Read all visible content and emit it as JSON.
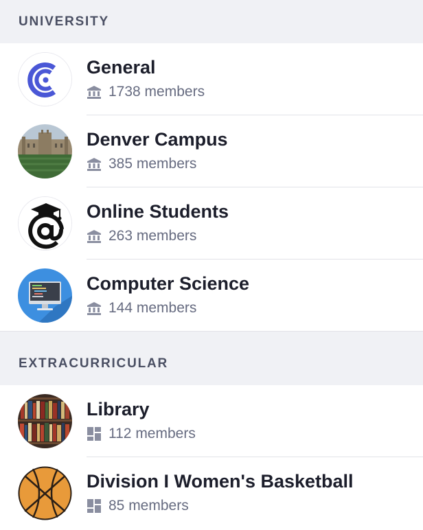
{
  "sections": [
    {
      "title": "UNIVERSITY",
      "items": [
        {
          "name": "General",
          "members": "1738 members",
          "icon": "institution-icon"
        },
        {
          "name": "Denver Campus",
          "members": "385 members",
          "icon": "institution-icon"
        },
        {
          "name": "Online Students",
          "members": "263 members",
          "icon": "institution-icon"
        },
        {
          "name": "Computer Science",
          "members": "144 members",
          "icon": "institution-icon"
        }
      ]
    },
    {
      "title": "EXTRACURRICULAR",
      "items": [
        {
          "name": "Library",
          "members": "112 members",
          "icon": "grid-icon"
        },
        {
          "name": "Division I Women's Basketball",
          "members": "85 members",
          "icon": "grid-icon"
        }
      ]
    }
  ],
  "colors": {
    "section_bg": "#f0f1f5",
    "title_text": "#1c1e2b",
    "meta_text": "#666b80",
    "brand_blue": "#4a57d6"
  }
}
